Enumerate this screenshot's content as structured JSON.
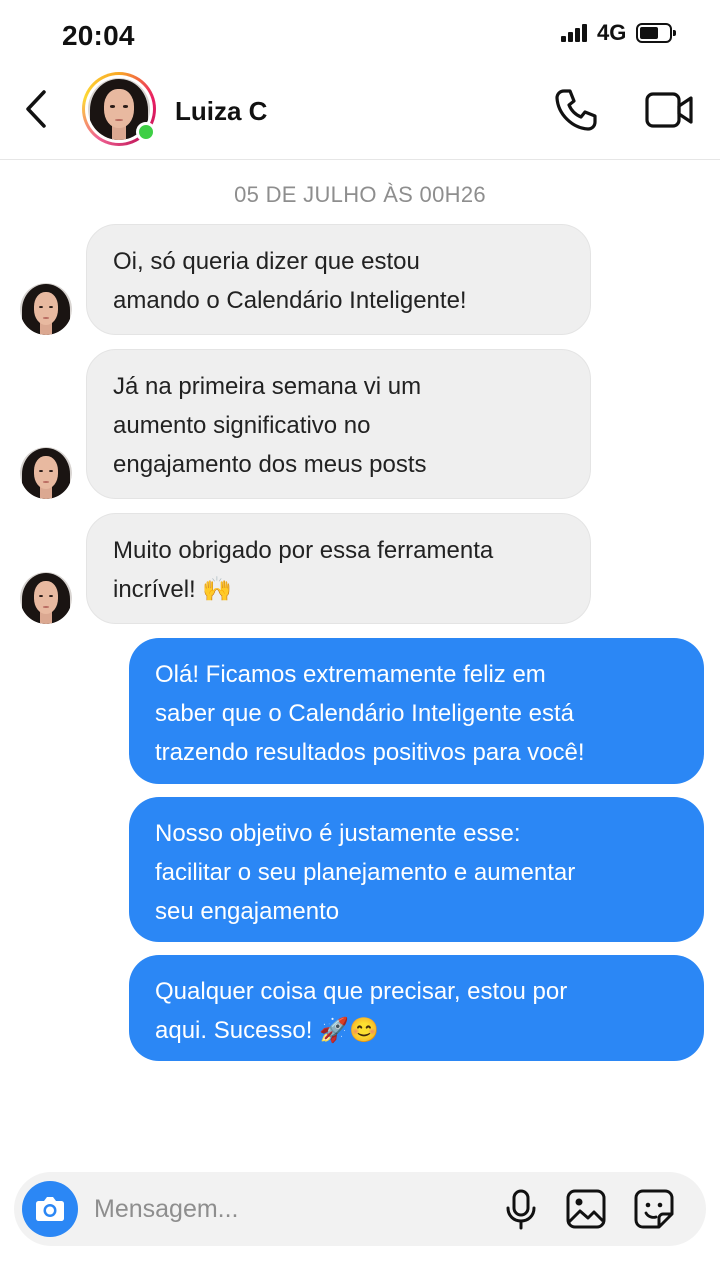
{
  "status_bar": {
    "time": "20:04",
    "network": "4G"
  },
  "header": {
    "contact_name": "Luiza C",
    "icons": {
      "back": "back-arrow-icon",
      "call": "phone-icon",
      "video": "video-camera-icon"
    },
    "online": true
  },
  "chat": {
    "date_label": "05 DE JULHO ÀS 00H26",
    "messages": [
      {
        "direction": "incoming",
        "lines": [
          "Oi, só queria dizer que estou",
          "amando o Calendário Inteligente!"
        ]
      },
      {
        "direction": "incoming",
        "lines": [
          "Já na primeira semana vi um",
          "aumento significativo no",
          "engajamento dos meus posts"
        ]
      },
      {
        "direction": "incoming",
        "lines": [
          "Muito obrigado por essa ferramenta",
          "incrível! 🙌"
        ]
      },
      {
        "direction": "outgoing",
        "lines": [
          "Olá! Ficamos extremamente feliz em",
          "saber que o Calendário Inteligente está",
          "trazendo resultados positivos para você!"
        ]
      },
      {
        "direction": "outgoing",
        "lines": [
          "Nosso objetivo é justamente esse:",
          "facilitar o seu planejamento e aumentar",
          "seu engajamento"
        ]
      },
      {
        "direction": "outgoing",
        "lines": [
          "Qualquer coisa que precisar, estou por",
          "aqui. Sucesso! 🚀😊"
        ]
      }
    ]
  },
  "composer": {
    "placeholder": "Mensagem...",
    "value": "",
    "icons": {
      "camera": "camera-icon",
      "mic": "microphone-icon",
      "gallery": "image-gallery-icon",
      "sticker": "sticker-icon"
    }
  },
  "colors": {
    "outgoing_bubble": "#2b87f5",
    "incoming_bubble": "#efefef",
    "online": "#3ecf45"
  }
}
